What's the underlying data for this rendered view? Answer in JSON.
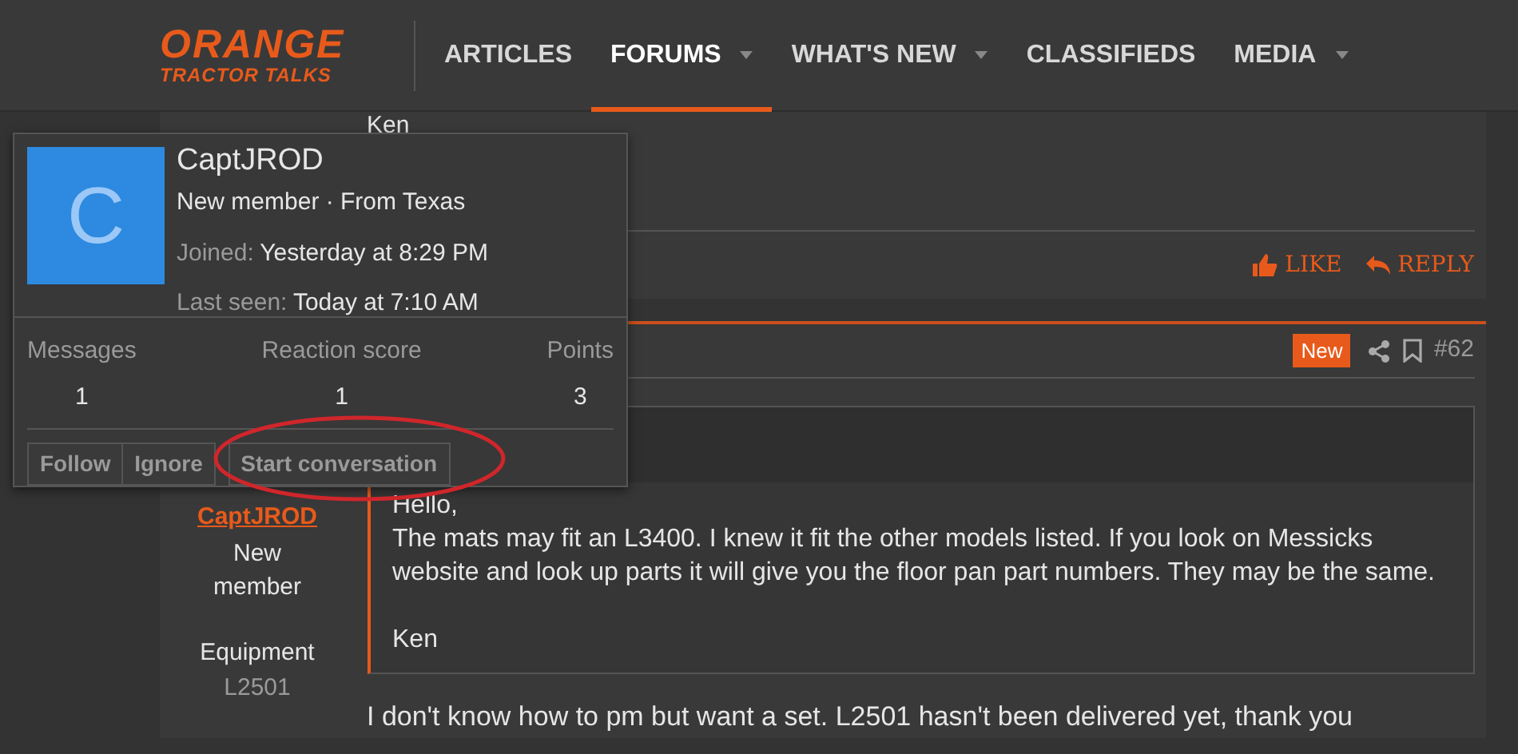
{
  "logo": {
    "line_1": "ORANGE",
    "line_2": "TRACTOR TALKS"
  },
  "nav": [
    {
      "label": "ARTICLES",
      "selected": false,
      "dropdown": false
    },
    {
      "label": "FORUMS",
      "selected": true,
      "dropdown": true
    },
    {
      "label": "WHAT'S NEW",
      "selected": false,
      "dropdown": true
    },
    {
      "label": "CLASSIFIEDS",
      "selected": false,
      "dropdown": false
    },
    {
      "label": "MEDIA",
      "selected": false,
      "dropdown": true
    }
  ],
  "previous_post": {
    "body": "Ken",
    "actions": [
      {
        "kind": "like",
        "label": "LIKE"
      },
      {
        "kind": "reply",
        "label": "REPLY"
      }
    ]
  },
  "post": {
    "badge": "New",
    "number": "#62",
    "author": "CaptJROD",
    "role_lines": [
      "New",
      "member"
    ],
    "equipment_label": "Equipment",
    "equipment": "L2501",
    "quote_paragraphs": [
      "Hello,\nThe mats may fit an L3400. I knew it fit the other models listed. If you look on Messicks website and look up parts it will give you the floor pan part numbers. They may be the same.",
      "Ken"
    ],
    "body": "I don't know how to pm but want a set. L2501 hasn't been delivered yet, thank you"
  },
  "member_card": {
    "avatar_letter": "C",
    "name": "CaptJROD",
    "subtitle": "New member · From Texas",
    "facts": [
      {
        "label": "Joined:",
        "value": "Yesterday at 8:29 PM"
      },
      {
        "label": "Last seen:",
        "value": "Today at 7:10 AM"
      }
    ],
    "stats": [
      {
        "label": "Messages",
        "value": "1"
      },
      {
        "label": "Reaction score",
        "value": "1"
      },
      {
        "label": "Points",
        "value": "3"
      }
    ],
    "buttons": [
      {
        "label": "Follow",
        "highlighted": false
      },
      {
        "label": "Ignore",
        "highlighted": false
      },
      {
        "label": "Start conversation",
        "highlighted": true
      }
    ]
  }
}
